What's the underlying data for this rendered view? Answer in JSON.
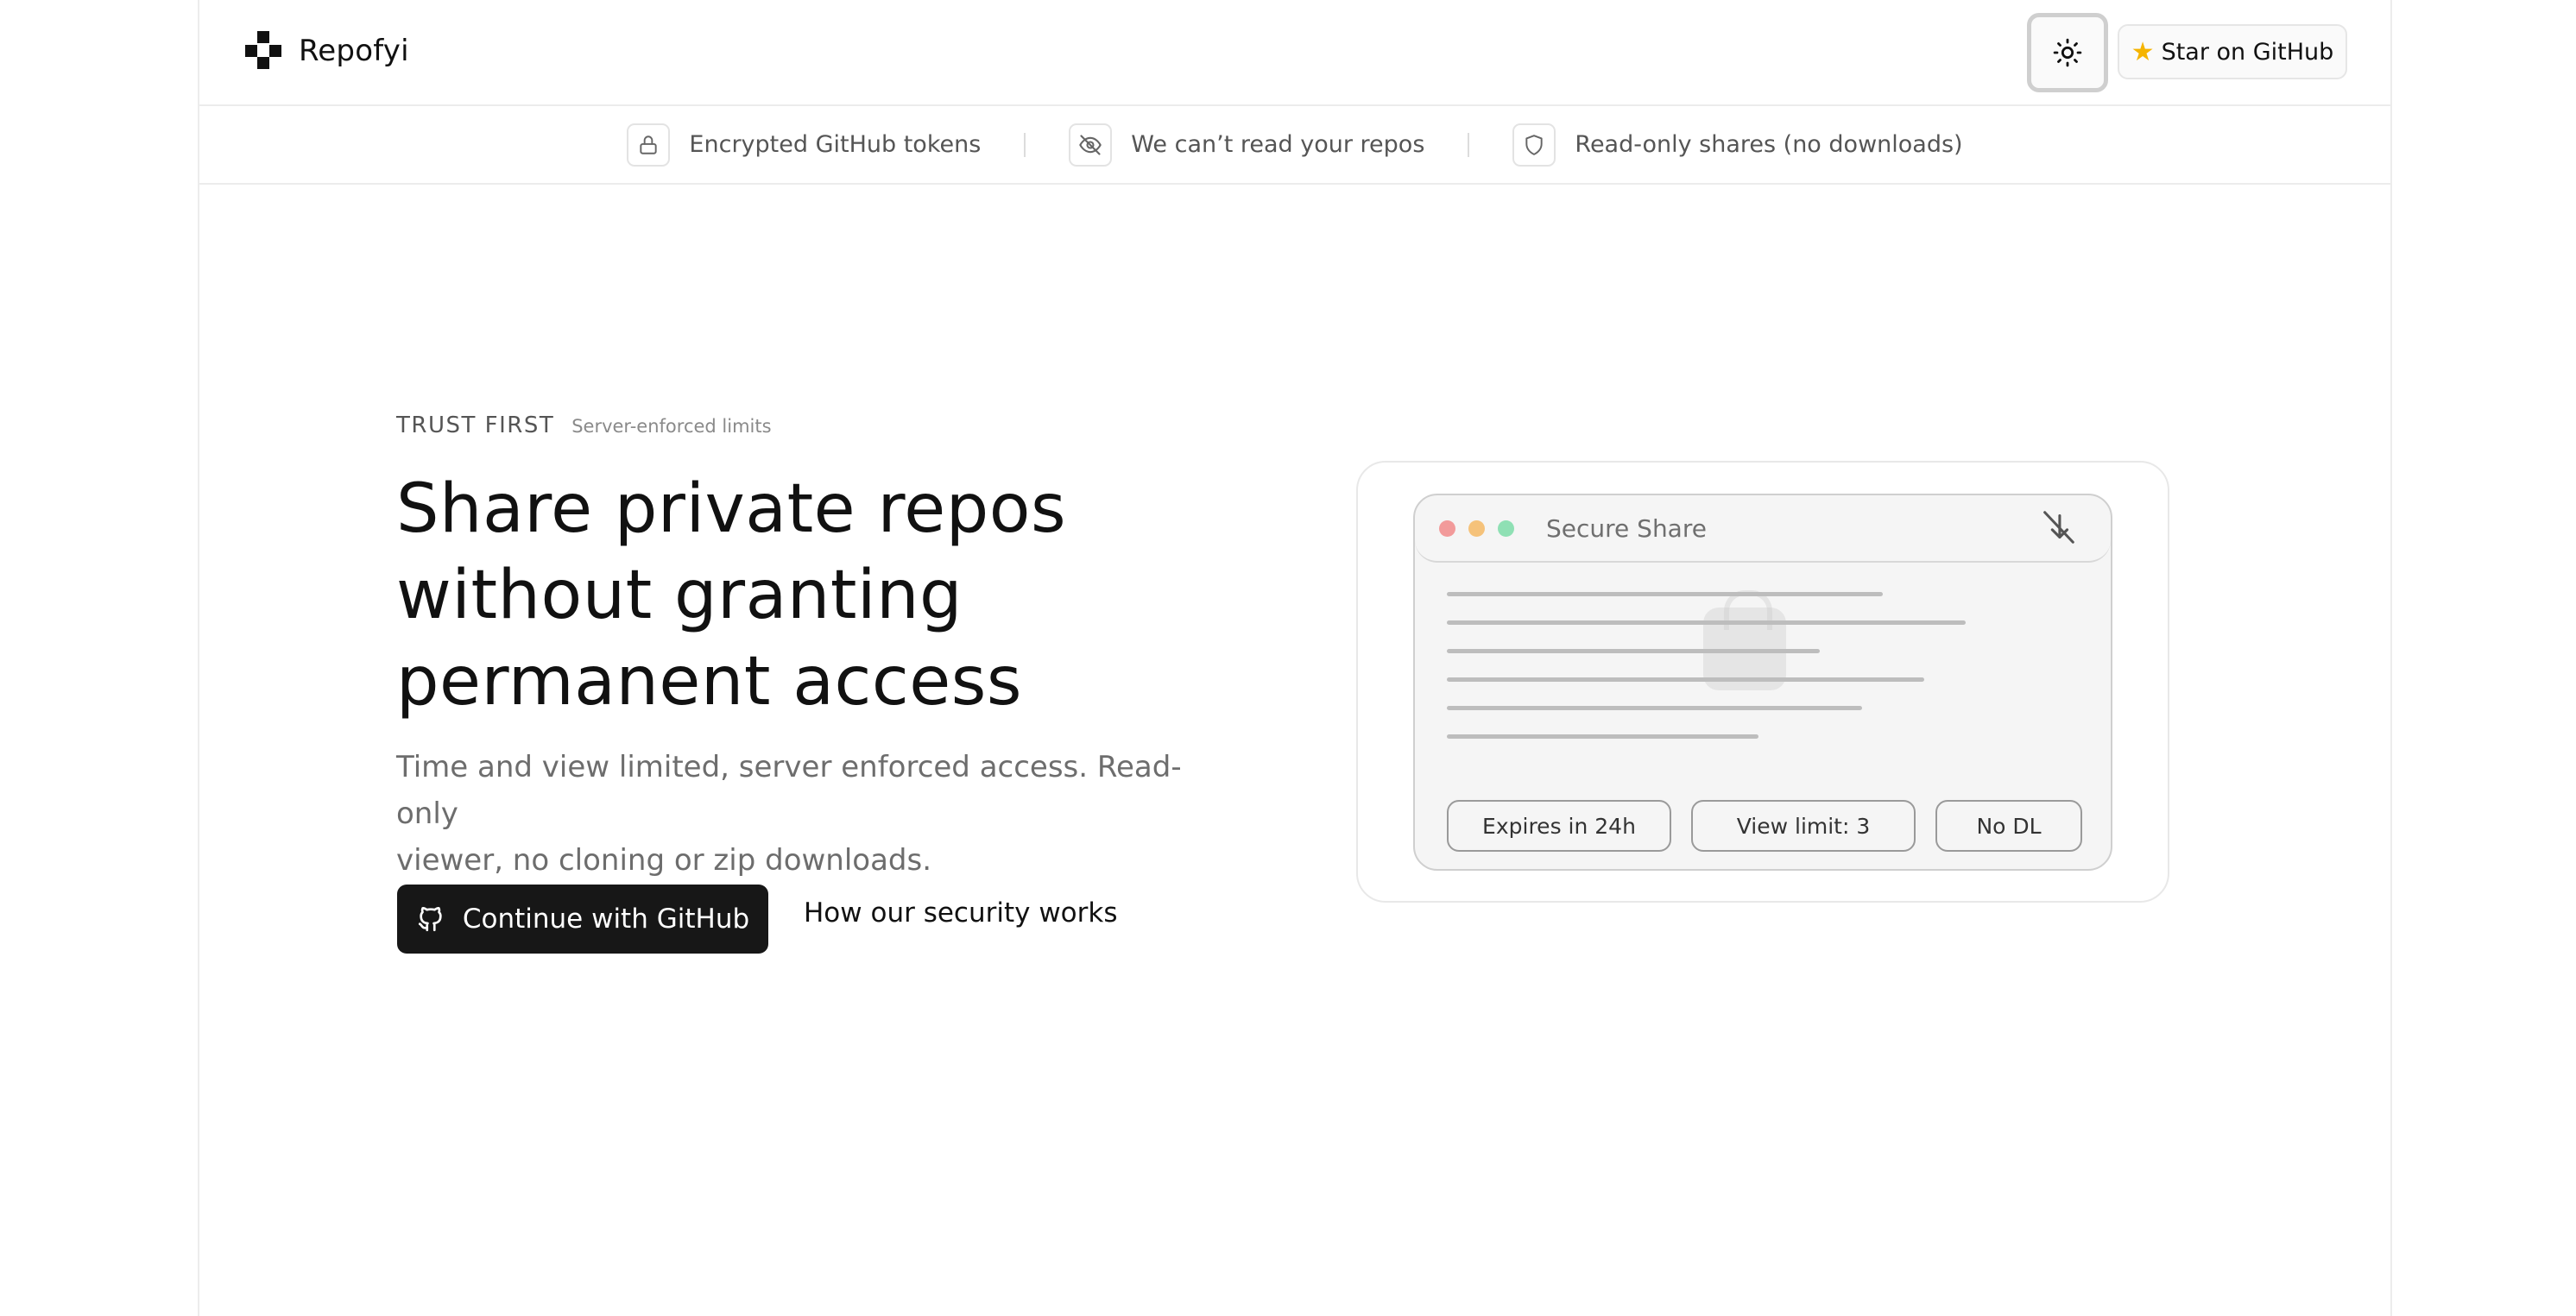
{
  "header": {
    "brand_name": "Repofyi",
    "star_label": "Star on GitHub"
  },
  "trustbar": {
    "items": [
      {
        "icon": "lock-icon",
        "label": "Encrypted GitHub tokens"
      },
      {
        "icon": "eye-off-icon",
        "label": "We can’t read your repos"
      },
      {
        "icon": "shield-icon",
        "label": "Read-only shares (no downloads)"
      }
    ]
  },
  "hero": {
    "eyebrow_main": "TRUST FIRST",
    "eyebrow_sub": "Server-enforced limits",
    "title_line1": "Share private repos",
    "title_line2": "without granting",
    "title_line3": "permanent access",
    "description_line1": "Time and view limited, server enforced access. Read-only",
    "description_line2": "viewer, no cloning or zip downloads.",
    "cta_primary": "Continue with GitHub",
    "cta_secondary": "How our security works"
  },
  "preview": {
    "window_title": "Secure Share",
    "pills": [
      "Expires in 24h",
      "View limit: 3",
      "No DL"
    ]
  },
  "colors": {
    "primary_button": "#171717",
    "border": "#ececec",
    "muted_text": "#6d6d6d",
    "dot_red": "#f29a9a",
    "dot_yellow": "#f5c27a",
    "dot_green": "#8fe0b4"
  }
}
